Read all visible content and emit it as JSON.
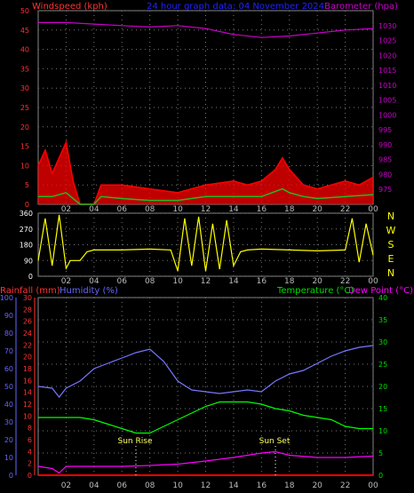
{
  "header": {
    "left_label": "Windspeed (kph)",
    "center_label": "24 hour graph data: 04 November 2024",
    "right_label": "Barometer (hpa)"
  },
  "lower_header": {
    "rain_label": "Rainfall (mm)",
    "humidity_label": "Humidity (%)",
    "temp_label": "Temperature (°C)",
    "dew_label": "Dew Point (°C)"
  },
  "annotations": {
    "sunrise": "Sun Rise",
    "sunset": "Sun Set"
  },
  "compass": [
    "N",
    "W",
    "S",
    "E",
    "N"
  ],
  "colors": {
    "wind": "#ff0000",
    "wind_avg": "#22bb22",
    "wind_low": "#ffffff",
    "baro": "#cc00cc",
    "dir": "#ffff00",
    "humidity": "#7777ff",
    "temp": "#00ff00",
    "dew": "#ff00ff",
    "rain": "#ff0000",
    "axis_red": "#ff3333",
    "axis_blue": "#6666ff",
    "axis_green": "#00dd00"
  },
  "x_ticks": [
    "02",
    "04",
    "06",
    "08",
    "10",
    "12",
    "14",
    "16",
    "18",
    "20",
    "22",
    "00"
  ],
  "chart_data": [
    {
      "type": "line",
      "name": "windspeed-barometer",
      "x_range": [
        0,
        24
      ],
      "y_left": {
        "label": "Windspeed (kph)",
        "range": [
          0,
          50
        ],
        "ticks": [
          0,
          5,
          10,
          15,
          20,
          25,
          30,
          35,
          40,
          45,
          50
        ]
      },
      "y_right": {
        "label": "Barometer (hpa)",
        "range": [
          970,
          1035
        ],
        "ticks": [
          975,
          980,
          985,
          990,
          995,
          1000,
          1005,
          1010,
          1015,
          1020,
          1025,
          1030
        ]
      },
      "series": [
        {
          "key": "barometer",
          "axis": "right",
          "x": [
            0,
            2,
            4,
            6,
            8,
            10,
            12,
            14,
            16,
            18,
            20,
            22,
            24
          ],
          "values": [
            1031,
            1031,
            1030.5,
            1030,
            1029.5,
            1030,
            1029,
            1027,
            1026,
            1026.5,
            1027.5,
            1028.5,
            1029
          ]
        },
        {
          "key": "wind_gust",
          "axis": "left",
          "x": [
            0,
            0.5,
            1,
            1.5,
            2,
            2.5,
            3,
            4,
            4.5,
            6,
            8,
            10,
            12,
            14,
            15,
            16,
            17,
            17.5,
            18,
            19,
            20,
            21,
            22,
            23,
            24
          ],
          "values": [
            10,
            14,
            8,
            12,
            16,
            6,
            0,
            0,
            5,
            5,
            4,
            3,
            5,
            6,
            5,
            6,
            9,
            12,
            9,
            5,
            4,
            5,
            6,
            5,
            7
          ]
        },
        {
          "key": "wind_avg",
          "axis": "left",
          "x": [
            0,
            1,
            2,
            3,
            4,
            4.5,
            6,
            8,
            10,
            12,
            14,
            16,
            17.5,
            18,
            19,
            20,
            22,
            24
          ],
          "values": [
            2,
            2,
            3,
            0,
            0,
            2,
            1.5,
            1,
            1,
            2,
            2,
            2,
            4,
            3,
            2,
            1.5,
            2,
            2.5
          ]
        }
      ]
    },
    {
      "type": "scatter",
      "name": "wind-direction",
      "x_range": [
        0,
        24
      ],
      "y_range": [
        0,
        360
      ],
      "y_ticks": [
        0,
        90,
        180,
        270,
        360
      ],
      "series": [
        {
          "key": "direction",
          "x": [
            0,
            0.5,
            1,
            1.5,
            2,
            2.3,
            3,
            3.5,
            4,
            6,
            8,
            9.5,
            10,
            10.5,
            11,
            11.5,
            12,
            12.5,
            13,
            13.5,
            14,
            14.5,
            15,
            16,
            18,
            20,
            22,
            22.5,
            23,
            23.5,
            24
          ],
          "values": [
            90,
            330,
            60,
            350,
            45,
            90,
            90,
            140,
            150,
            150,
            155,
            150,
            30,
            330,
            60,
            340,
            30,
            300,
            40,
            320,
            60,
            140,
            150,
            155,
            150,
            145,
            150,
            330,
            80,
            300,
            120
          ]
        }
      ]
    },
    {
      "type": "line",
      "name": "rain-humidity-temperature",
      "x_range": [
        0,
        24
      ],
      "y_left_rain": {
        "label": "Rainfall (mm)",
        "range": [
          0,
          30
        ],
        "ticks": [
          0,
          2,
          4,
          6,
          8,
          10,
          12,
          14,
          16,
          18,
          20,
          22,
          24,
          26,
          28,
          30
        ]
      },
      "y_left_humidity": {
        "label": "Humidity (%)",
        "range": [
          0,
          100
        ],
        "ticks": [
          0,
          10,
          20,
          30,
          40,
          50,
          60,
          70,
          80,
          90,
          100
        ]
      },
      "y_right": {
        "label": "Temperature (°C)",
        "range": [
          0,
          40
        ],
        "ticks": [
          0,
          5,
          10,
          15,
          20,
          25,
          30,
          35,
          40
        ]
      },
      "series": [
        {
          "key": "humidity",
          "axis": "humidity",
          "x": [
            0,
            1,
            1.5,
            2,
            3,
            4,
            5,
            6,
            7,
            8,
            9,
            10,
            11,
            12,
            13,
            14,
            15,
            16,
            17,
            18,
            19,
            20,
            21,
            22,
            23,
            24
          ],
          "values": [
            50,
            49,
            44,
            49,
            53,
            60,
            63,
            66,
            69,
            71,
            64,
            53,
            48,
            47,
            46,
            47,
            48,
            47,
            53,
            57,
            59,
            63,
            67,
            70,
            72,
            73
          ]
        },
        {
          "key": "temperature",
          "axis": "right",
          "x": [
            0,
            1,
            2,
            3,
            4,
            5,
            6,
            7,
            8,
            9,
            10,
            11,
            12,
            13,
            14,
            15,
            16,
            17,
            18,
            19,
            20,
            21,
            22,
            23,
            24
          ],
          "values": [
            13,
            13,
            13,
            13,
            12.5,
            11.5,
            10.5,
            9.5,
            9.5,
            11,
            12.5,
            14,
            15.5,
            16.5,
            16.5,
            16.5,
            16,
            15,
            14.5,
            13.5,
            13,
            12.5,
            11,
            10.5,
            10.5
          ]
        },
        {
          "key": "dew_point",
          "axis": "right",
          "x": [
            0,
            1,
            1.5,
            2,
            3,
            4,
            6,
            8,
            10,
            12,
            14,
            16,
            17,
            18,
            20,
            22,
            24
          ],
          "values": [
            2,
            1.5,
            0.5,
            2,
            2,
            2,
            2,
            2.2,
            2.5,
            3.2,
            4,
            5,
            5.3,
            4.5,
            4,
            4,
            4.3
          ]
        },
        {
          "key": "rainfall",
          "axis": "rain",
          "x": [
            0,
            24
          ],
          "values": [
            0,
            0
          ]
        }
      ]
    }
  ]
}
